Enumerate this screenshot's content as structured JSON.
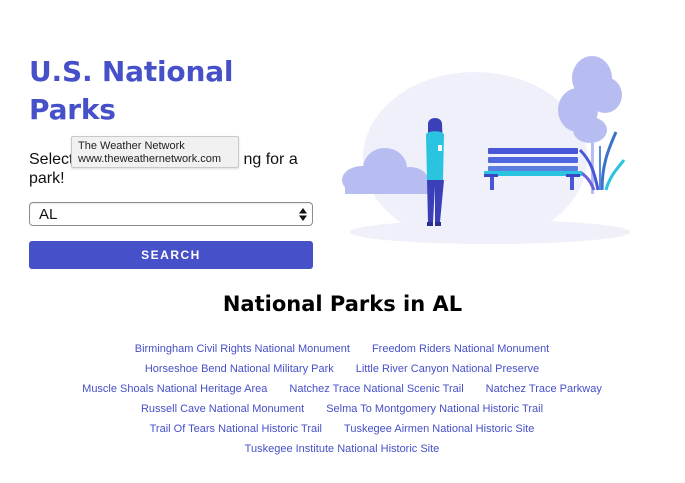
{
  "header": {
    "title_line1": "U.S. National",
    "title_line2": "Parks"
  },
  "form": {
    "prompt_before": "Select",
    "prompt_after": "ng for a",
    "prompt_line2": "park!",
    "select_value": "AL",
    "search_label": "SEARCH"
  },
  "tooltip": {
    "name": "The Weather Network",
    "url": "www.theweathernetwork.com"
  },
  "results": {
    "heading": "National Parks in AL",
    "rows": [
      [
        "Birmingham Civil Rights National Monument",
        "Freedom Riders National Monument"
      ],
      [
        "Horseshoe Bend National Military Park",
        "Little River Canyon National Preserve"
      ],
      [
        "Muscle Shoals National Heritage Area",
        "Natchez Trace National Scenic Trail",
        "Natchez Trace Parkway"
      ],
      [
        "Russell Cave National Monument",
        "Selma To Montgomery National Historic Trail"
      ],
      [
        "Trail Of Tears National Historic Trail",
        "Tuskegee Airmen National Historic Site"
      ],
      [
        "Tuskegee Institute National Historic Site"
      ]
    ]
  },
  "colors": {
    "accent": "#4650c9",
    "illustration_blue": "#4a56d8",
    "illustration_cyan": "#2bc4e0",
    "illustration_lavender": "#b8bdf1",
    "illustration_bg": "#eff0fa"
  },
  "icons": {
    "select_arrows": "updown-arrows-icon"
  }
}
